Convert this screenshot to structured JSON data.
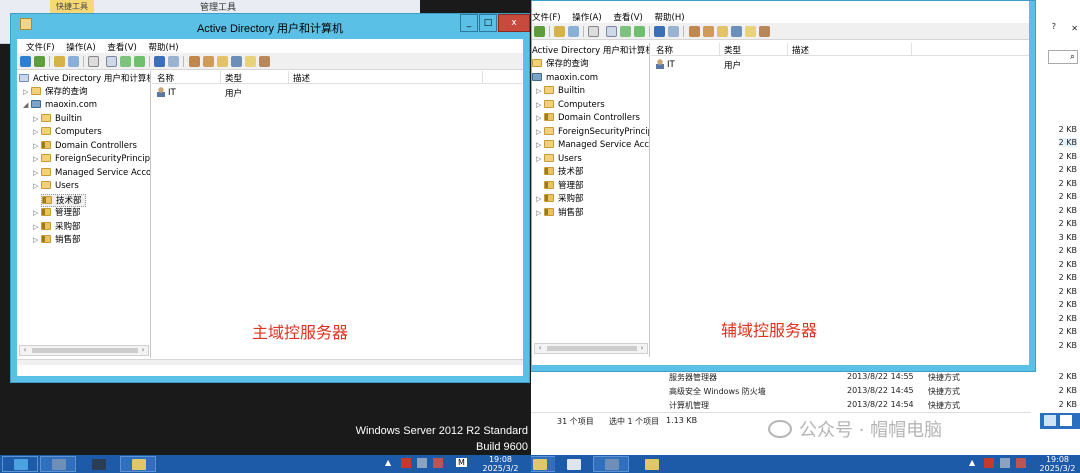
{
  "left": {
    "bg": {
      "tab": "快捷工具",
      "title": "管理工具"
    },
    "window": {
      "title": "Active Directory 用户和计算机",
      "minimize": "_",
      "maximize": "□",
      "close": "x"
    },
    "menu": [
      "文件(F)",
      "操作(A)",
      "查看(V)",
      "帮助(H)"
    ],
    "tree": {
      "root": "Active Directory 用户和计算机",
      "saved": "保存的查询",
      "domain": "maoxin.com",
      "children": [
        "Builtin",
        "Computers",
        "Domain Controllers",
        "ForeignSecurityPrincipals",
        "Managed Service Accounts",
        "Users",
        "技术部",
        "管理部",
        "采购部",
        "销售部"
      ]
    },
    "columns": [
      "名称",
      "类型",
      "描述"
    ],
    "rows": [
      {
        "name": "IT",
        "type": "用户",
        "desc": ""
      }
    ],
    "label": "主域控服务器",
    "os": {
      "line1": "Windows Server 2012 R2 Standard",
      "line2": "Build 9600"
    },
    "clock": {
      "time": "19:08",
      "date": "2025/3/2"
    },
    "tray_m": "M"
  },
  "right": {
    "menu": [
      "文件(F)",
      "操作(A)",
      "查看(V)",
      "帮助(H)"
    ],
    "tree": {
      "root": "Active Directory 用户和计算机",
      "saved": "保存的查询",
      "domain": "maoxin.com",
      "children": [
        "Builtin",
        "Computers",
        "Domain Controllers",
        "ForeignSecurityPrincipals",
        "Managed Service Accounts",
        "Users",
        "技术部",
        "管理部",
        "采购部",
        "销售部"
      ]
    },
    "columns": [
      "名称",
      "类型",
      "描述"
    ],
    "rows": [
      {
        "name": "IT",
        "type": "用户",
        "desc": ""
      }
    ],
    "label": "辅域控服务器",
    "explorer_rows": [
      {
        "name": "服务器管理器",
        "date": "2013/8/22 14:55",
        "type": "快捷方式",
        "size": "2 KB"
      },
      {
        "name": "高级安全 Windows 防火墙",
        "date": "2013/8/22 14:45",
        "type": "快捷方式",
        "size": "2 KB"
      },
      {
        "name": "计算机管理",
        "date": "2013/8/22 14:54",
        "type": "快捷方式",
        "size": "2 KB"
      }
    ],
    "status": {
      "count": "31 个项目",
      "selected": "选中 1 个项目",
      "size": "1.13 KB"
    },
    "sizes": [
      "2 KB",
      "2 KB",
      "2 KB",
      "2 KB",
      "2 KB",
      "2 KB",
      "2 KB",
      "2 KB",
      "3 KB",
      "2 KB",
      "2 KB",
      "2 KB",
      "2 KB",
      "2 KB",
      "2 KB",
      "2 KB",
      "2 KB"
    ],
    "watermark": "公众号 · 帽帽电脑",
    "os": {
      "line2": "Build 960"
    },
    "clock": {
      "time": "19:08",
      "date": "2025/3/2"
    },
    "close_x": "✕",
    "search_icon": "⌕",
    "nav_q": "?"
  }
}
